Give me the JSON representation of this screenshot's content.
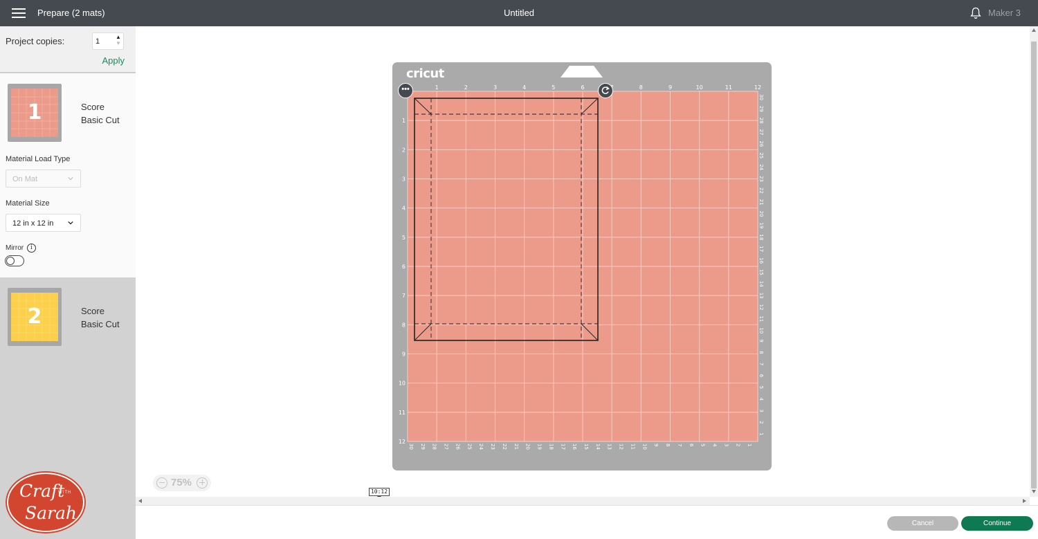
{
  "header": {
    "title": "Prepare (2 mats)",
    "document_title": "Untitled",
    "machine": "Maker 3",
    "menu_icon": "hamburger-menu-icon",
    "notification_icon": "bell-icon"
  },
  "sidebar": {
    "copies_label": "Project copies:",
    "copies_value": "1",
    "apply_label": "Apply",
    "mats": [
      {
        "number": "1",
        "operation_1": "Score",
        "operation_2": "Basic Cut",
        "color": "#ec9a8a",
        "selected": true
      },
      {
        "number": "2",
        "operation_1": "Score",
        "operation_2": "Basic Cut",
        "color": "#fcd04b",
        "selected": false
      }
    ],
    "load_type_label": "Material Load Type",
    "load_type_value": "On Mat",
    "size_label": "Material Size",
    "size_value": "12 in x 12 in",
    "mirror_label": "Mirror",
    "mirror_on": false
  },
  "mat": {
    "brand": "cricut",
    "top_ticks": [
      "1",
      "2",
      "3",
      "4",
      "5",
      "6",
      "7",
      "8",
      "9",
      "10",
      "11",
      "12"
    ],
    "left_ticks": [
      "1",
      "2",
      "3",
      "4",
      "5",
      "6",
      "7",
      "8",
      "9",
      "10",
      "11",
      "12"
    ],
    "bottom_ticks": [
      "30",
      "29",
      "28",
      "27",
      "26",
      "25",
      "24",
      "23",
      "22",
      "21",
      "20",
      "19",
      "18",
      "17",
      "16",
      "15",
      "14",
      "13",
      "12",
      "11",
      "10",
      "9",
      "8",
      "7",
      "6",
      "5",
      "4",
      "3",
      "2",
      "1"
    ],
    "right_ticks": [
      "30",
      "29",
      "28",
      "27",
      "26",
      "25",
      "24",
      "23",
      "22",
      "21",
      "20",
      "19",
      "18",
      "17",
      "16",
      "15",
      "14",
      "13",
      "12",
      "11",
      "10",
      "9",
      "8",
      "7",
      "6",
      "5",
      "4",
      "3",
      "2",
      "1"
    ],
    "more_icon": "more-dots-icon",
    "rotate_icon": "rotate-icon",
    "mat_color": "#ec9a8a"
  },
  "canvas": {
    "zoom": "75%",
    "time_badge": "10:12"
  },
  "footer": {
    "cancel_label": "Cancel",
    "continue_label": "Continue"
  },
  "logo": {
    "line1": "Craft",
    "small": "WITH",
    "line2": "Sarah"
  },
  "colors": {
    "header_bg": "#454a50",
    "accent_green": "#0d7a52",
    "apply_green": "#1a8a5c"
  }
}
